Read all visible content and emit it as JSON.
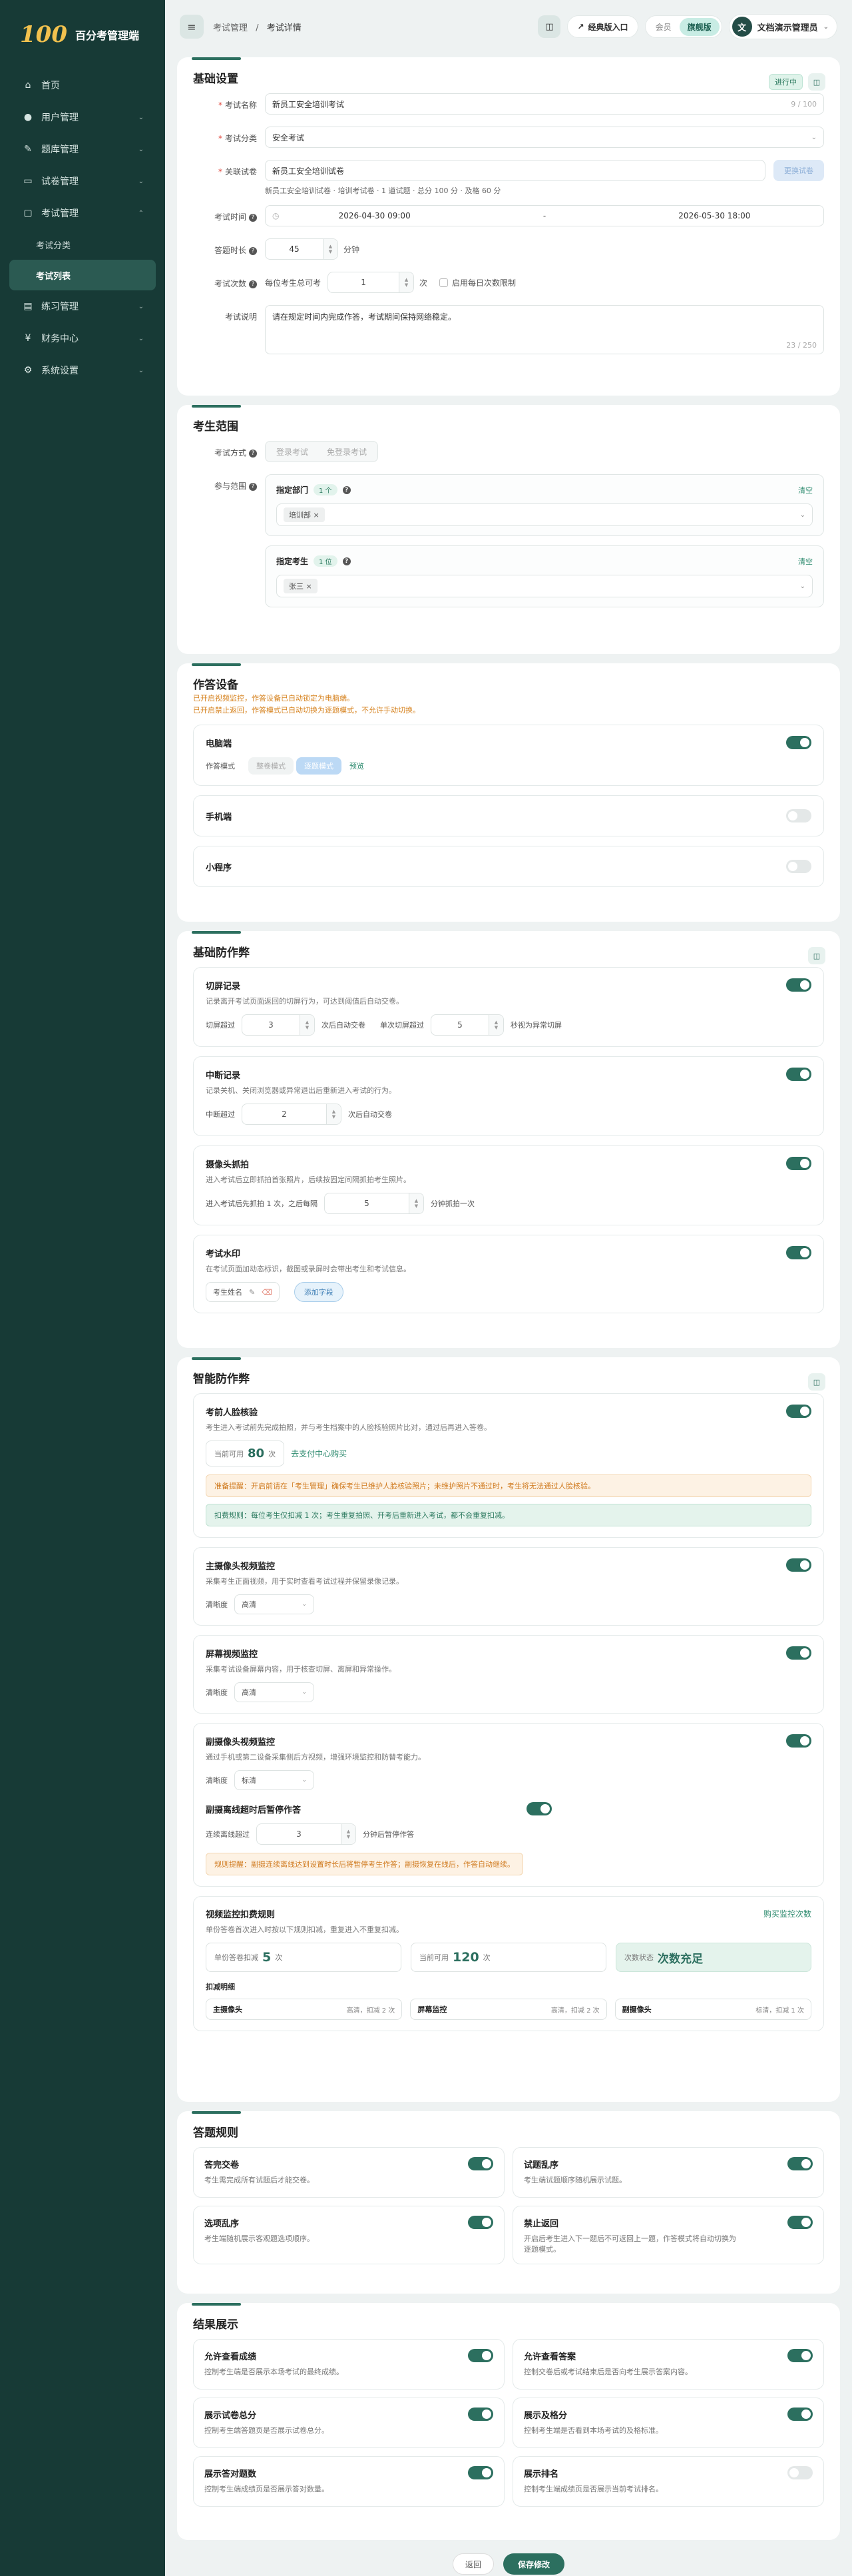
{
  "app": {
    "logo": "100",
    "name": "百分考管理端"
  },
  "nav": {
    "items": [
      {
        "label": "首页",
        "icon": "home-icon",
        "glyph": "⌂"
      },
      {
        "label": "用户管理",
        "icon": "user-icon",
        "glyph": "●"
      },
      {
        "label": "题库管理",
        "icon": "edit-icon",
        "glyph": "✎"
      },
      {
        "label": "试卷管理",
        "icon": "paper-icon",
        "glyph": "▭"
      },
      {
        "label": "考试管理",
        "icon": "exam-icon",
        "glyph": "▢"
      },
      {
        "label": "考试分类"
      },
      {
        "label": "考试列表"
      },
      {
        "label": "练习管理",
        "icon": "practice-icon",
        "glyph": "▤"
      },
      {
        "label": "财务中心",
        "icon": "finance-icon",
        "glyph": "¥"
      },
      {
        "label": "系统设置",
        "icon": "settings-icon",
        "glyph": "⚙"
      }
    ]
  },
  "topbar": {
    "crumb_1": "考试管理",
    "crumb_sep": "/",
    "crumb_2": "考试详情",
    "classic_entry": "经典版入口",
    "seg_member": "会员",
    "seg_flagship": "旗舰版",
    "user": "文档演示管理员",
    "avatar": "文"
  },
  "basic": {
    "title": "基础设置",
    "status": "进行中",
    "name_label": "考试名称",
    "name_value": "新员工安全培训考试",
    "name_count": "9 / 100",
    "category_label": "考试分类",
    "category_value": "安全考试",
    "paper_label": "关联试卷",
    "paper_value": "新员工安全培训试卷",
    "paper_btn": "更换试卷",
    "paper_hint": "新员工安全培训试卷 · 培训考试卷 · 1 道试题 · 总分 100 分 · 及格 60 分",
    "time_label": "考试时间",
    "time_start": "2026-04-30 09:00",
    "time_sep": "-",
    "time_end": "2026-05-30 18:00",
    "duration_label": "答题时长",
    "duration_value": "45",
    "duration_unit": "分钟",
    "times_label": "考试次数",
    "times_prefix": "每位考生总可考",
    "times_value": "1",
    "times_unit": "次",
    "times_daily": "启用每日次数限制",
    "desc_label": "考试说明",
    "desc_value": "请在规定时间内完成作答，考试期间保持网络稳定。",
    "desc_count": "23 / 250"
  },
  "scope": {
    "title": "考生范围",
    "mode_label": "考试方式",
    "mode_login": "登录考试",
    "mode_free": "免登录考试",
    "range_label": "参与范围",
    "dept_title": "指定部门",
    "dept_count": "1 个",
    "dept_clear": "清空",
    "dept_chip": "培训部",
    "student_title": "指定考生",
    "student_count": "1 位",
    "student_clear": "清空",
    "student_chip": "张三"
  },
  "answer": {
    "title": "作答设备",
    "notice_1": "已开启视频监控，作答设备已自动锁定为电脑端。",
    "notice_2": "已开启禁止返回，作答模式已自动切换为逐题模式，不允许手动切换。",
    "pc": "电脑端",
    "mode_label": "作答模式",
    "mode_full": "整卷模式",
    "mode_single": "逐题模式",
    "preview": "预览",
    "mobile": "手机端",
    "mini": "小程序"
  },
  "anticheat": {
    "title": "基础防作弊",
    "switch_title": "切屏记录",
    "switch_desc": "记录离开考试页面返回的切屏行为，可达到阈值后自动交卷。",
    "switch_pre": "切屏超过",
    "switch_value": "3",
    "switch_mid": "次后自动交卷",
    "switch_single": "单次切屏超过",
    "switch_sec": "5",
    "switch_post": "秒视为异常切屏",
    "break_title": "中断记录",
    "break_desc": "记录关机、关闭浏览器或异常退出后重新进入考试的行为。",
    "break_pre": "中断超过",
    "break_value": "2",
    "break_post": "次后自动交卷",
    "cam_title": "摄像头抓拍",
    "cam_desc": "进入考试后立即抓拍首张照片，后续按固定间隔抓拍考生照片。",
    "cam_pre": "进入考试后先抓拍 1 次，之后每隔",
    "cam_value": "5",
    "cam_post": "分钟抓拍一次",
    "wm_title": "考试水印",
    "wm_desc": "在考试页面加动态标识，截图或录屏时会带出考生和考试信息。",
    "wm_field": "考生姓名",
    "wm_add": "添加字段"
  },
  "smart": {
    "title": "智能防作弊",
    "face_title": "考前人脸核验",
    "face_desc": "考生进入考试前先完成拍照，并与考生档案中的人脸核验照片比对，通过后再进入答卷。",
    "face_quota_label": "当前可用",
    "face_quota": "80",
    "face_quota_unit": "次",
    "face_buy": "去支付中心购买",
    "face_warn": "准备提醒：开启前请在「考生管理」确保考生已维护人脸核验照片；未维护照片不通过时，考生将无法通过人脸核验。",
    "face_info": "扣费规则：每位考生仅扣减 1 次；考生重复拍照、开考后重新进入考试，都不会重复扣减。",
    "main_title": "主摄像头视频监控",
    "main_desc": "采集考生正面视频，用于实时查看考试过程并保留录像记录。",
    "main_clarity_label": "清晰度",
    "main_clarity": "高清",
    "screen_title": "屏幕视频监控",
    "screen_desc": "采集考试设备屏幕内容，用于核查切屏、离屏和异常操作。",
    "screen_clarity_label": "清晰度",
    "screen_clarity": "高清",
    "sub_title": "副摄像头视频监控",
    "sub_desc": "通过手机或第二设备采集侧后方视频，增强环境监控和防替考能力。",
    "sub_clarity_label": "清晰度",
    "sub_clarity": "标清",
    "offline_title": "副摄离线超时后暂停作答",
    "offline_pre": "连续离线超过",
    "offline_value": "3",
    "offline_post": "分钟后暂停作答",
    "offline_warn": "规则提醒：副摄连续离线达到设置时长后将暂停考生作答；副摄恢复在线后，作答自动继续。",
    "fee_title": "视频监控扣费规则",
    "fee_desc": "单份答卷首次进入时按以下规则扣减，重复进入不重复扣减。",
    "fee_buy": "购买监控次数",
    "fee_each_label": "单份答卷扣减",
    "fee_each": "5",
    "fee_each_unit": "次",
    "fee_avail_label": "当前可用",
    "fee_avail": "120",
    "fee_avail_unit": "次",
    "fee_status_label": "次数状态",
    "fee_status": "次数充足",
    "fee_detail_title": "扣减明细",
    "fee_src": [
      {
        "name": "主摄像头",
        "detail": "高清，扣减 2 次"
      },
      {
        "name": "屏幕监控",
        "detail": "高清，扣减 2 次"
      },
      {
        "name": "副摄像头",
        "detail": "标清，扣减 1 次"
      }
    ]
  },
  "rules": {
    "title": "答题规则",
    "items": [
      {
        "title": "答完交卷",
        "desc": "考生需完成所有试题后才能交卷。",
        "on": true
      },
      {
        "title": "试题乱序",
        "desc": "考生端试题顺序随机展示试题。",
        "on": true
      },
      {
        "title": "选项乱序",
        "desc": "考生端随机展示客观题选项顺序。",
        "on": true
      },
      {
        "title": "禁止返回",
        "desc": "开启后考生进入下一题后不可返回上一题，作答模式将自动切换为逐题模式。",
        "on": true
      }
    ]
  },
  "results": {
    "title": "结果展示",
    "items": [
      {
        "title": "允许查看成绩",
        "desc": "控制考生端是否展示本场考试的最终成绩。",
        "on": true
      },
      {
        "title": "允许查看答案",
        "desc": "控制交卷后或考试结束后是否向考生展示答案内容。",
        "on": true
      },
      {
        "title": "展示试卷总分",
        "desc": "控制考生端答题页是否展示试卷总分。",
        "on": true
      },
      {
        "title": "展示及格分",
        "desc": "控制考生端是否看到本场考试的及格标准。",
        "on": true
      },
      {
        "title": "展示答对题数",
        "desc": "控制考生端成绩页是否展示答对数量。",
        "on": true
      },
      {
        "title": "展示排名",
        "desc": "控制考生端成绩页是否展示当前考试排名。",
        "on": false
      }
    ]
  },
  "footer": {
    "back": "返回",
    "save": "保存修改"
  }
}
